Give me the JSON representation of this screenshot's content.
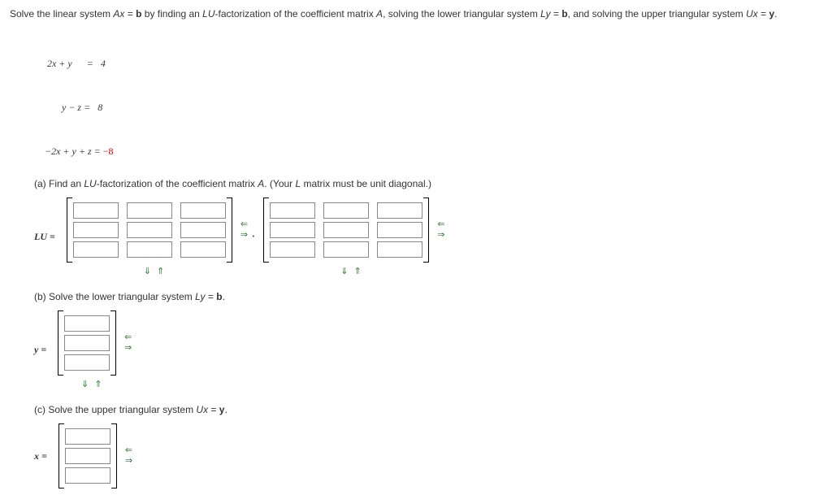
{
  "problem": {
    "intro_pre": "Solve the linear system ",
    "eqAx": "Ax",
    "eq_equals": " = ",
    "b_bold": "b",
    "intro_mid": " by finding an ",
    "LU": "LU",
    "intro_mid2": "-factorization of the coefficient matrix ",
    "A": "A",
    "intro_mid3": ", solving the lower triangular system  ",
    "Ly": "Ly",
    "intro_mid4": ",  and solving the upper triangular system  ",
    "Ux": "Ux",
    "y_bold": "y",
    "intro_end": "."
  },
  "system": {
    "row1": "  2x + y      =   4",
    "row2": "        y − z =   8",
    "row3_lhs": " −2x + y + z = ",
    "row3_rhs": "−8"
  },
  "partA": {
    "label": "(a) Find an ",
    "LU": "LU",
    "mid": "-factorization of the coefficient matrix ",
    "A": "A",
    "tail": ". (Your ",
    "L": "L",
    "tail2": " matrix must be unit diagonal.)",
    "answerLabel": "LU ="
  },
  "partB": {
    "label": "(b) Solve the lower triangular system  ",
    "Ly": "Ly",
    "eq": " = ",
    "b": "b",
    "tail": ".",
    "answerLabel": "y ="
  },
  "partC": {
    "label": "(c) Solve the upper triangular system  ",
    "Ux": "Ux",
    "eq": " = ",
    "y": "y",
    "tail": ".",
    "answerLabel": "x ="
  },
  "arrows": {
    "left": "⇐",
    "right": "⇒",
    "down": "⇓",
    "up": "⇑"
  }
}
